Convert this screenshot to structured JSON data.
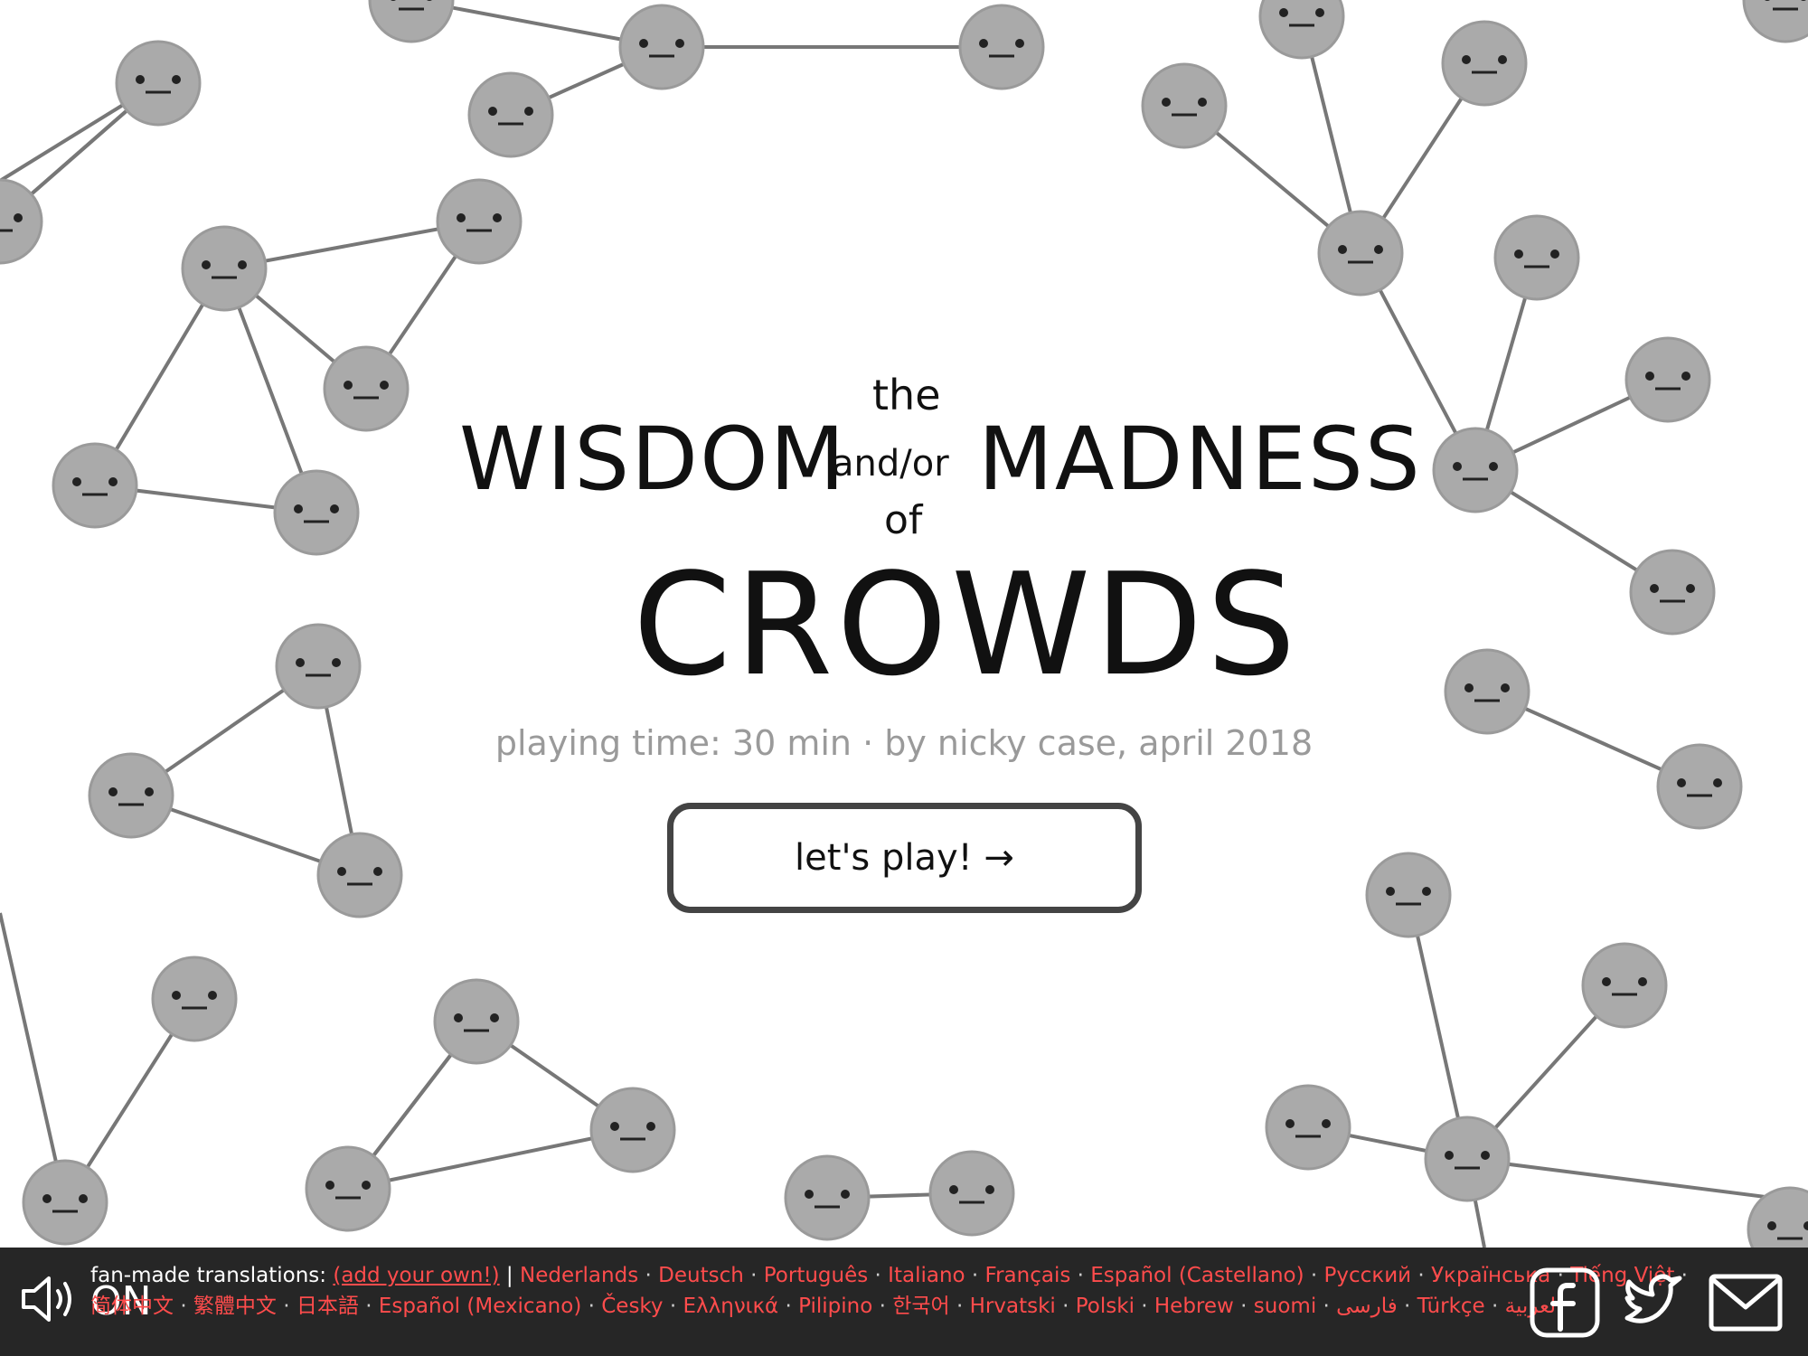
{
  "title": {
    "the": "the",
    "wisdom": "WISDOM",
    "and_or": "and/or",
    "madness": "MADNESS",
    "of": "of",
    "crowds": "CROWDS"
  },
  "subtitle": "playing time: 30 min · by nicky case, april 2018",
  "play_button_label": "let's play! →",
  "footer": {
    "sound_label": "ON",
    "translations_lead": "fan-made translations:",
    "add_own": "(add your own!)",
    "divider": "|",
    "languages": [
      "Nederlands",
      "Deutsch",
      "Português",
      "Italiano",
      "Français",
      "Español (Castellano)",
      "Русский",
      "Українська",
      "Tiếng Việt",
      "简体中文",
      "繁體中文",
      "日本語",
      "Español (Mexicano)",
      "Česky",
      "Ελληνικά",
      "Pilipino",
      "한국어",
      "Hrvatski",
      "Polski",
      "Hebrew",
      "suomi",
      "فارسی",
      "Türkçe",
      "العربية"
    ]
  },
  "icons": {
    "sound": "speaker-icon",
    "facebook": "facebook-icon",
    "twitter": "twitter-icon",
    "email": "email-icon"
  },
  "colors": {
    "node_fill": "#aaaaaa",
    "edge": "#777777",
    "footer_bg": "#262626",
    "link_red": "#ff4c4c",
    "subtitle_gray": "#9a9a9a"
  }
}
